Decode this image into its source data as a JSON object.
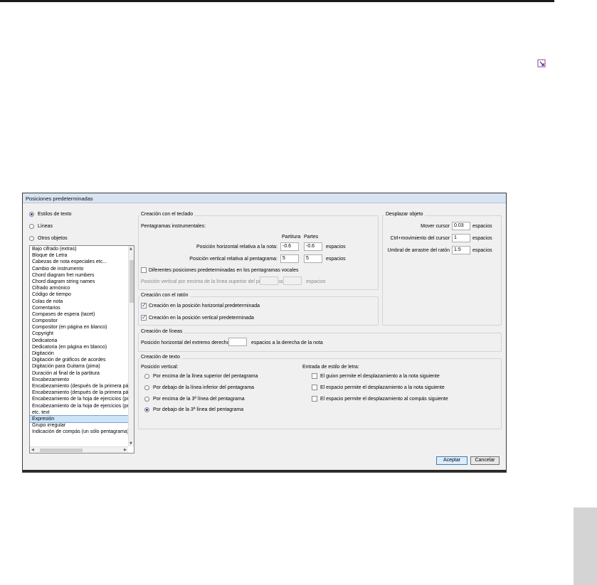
{
  "dialog": {
    "title": "Posiciones predeterminadas",
    "radios": [
      {
        "label": "Estilos de texto",
        "selected": true
      },
      {
        "label": "Líneas",
        "selected": false
      },
      {
        "label": "Otros objetos",
        "selected": false
      }
    ],
    "list_items": [
      "Bajo cifrado (extras)",
      "Bloque de Letra",
      "Cabezas de nota especiales etc...",
      "Cambio de instrumento",
      "Chord diagram fret numbers",
      "Chord diagram string names",
      "Cifrado armónico",
      "Código de tiempo",
      "Colas de nota",
      "Comentarios",
      "Compases de espera (tacet)",
      "Compositor",
      "Compositor (en página en blanco)",
      "Copyright",
      "Dedicatoria",
      "Dedicatoria (en página en blanco)",
      "Digitación",
      "Digitación de gráficos de acordes",
      "Digitación para Guitarra (pima)",
      "Duración al final de la partitura",
      "Encabezamiento",
      "Encabezamiento (después de la primera pág",
      "Encabezamiento (después de la primera pág",
      "Encabezamiento de la hoja de ejercicios (pri",
      "Encabezamiento de la hoja de ejercicios (pri",
      "etc. text",
      "Expresión",
      "Grupo irregular",
      "Indicación de compás (un sólo pentagrama)"
    ],
    "selected_list_item": "Expresión",
    "keyboard": {
      "title": "Creación con el teclado",
      "subtitle": "Pentagramas instrumentales:",
      "col_score": "Partitura",
      "col_parts": "Partes",
      "h_label": "Posición horizontal relativa a la nota:",
      "h_score": "-0.6",
      "h_parts": "-0.6",
      "v_label": "Posición vertical relativa al pentagrama:",
      "v_score": "5",
      "v_parts": "5",
      "units": "espacios",
      "vocal_check": "Diferentes posiciones predeterminadas en los pentagramas vocales",
      "vocal_label": "Posición vertical por encima de la línea superior del pentagrama:",
      "vocal_units": "espacios"
    },
    "move": {
      "title": "Desplazar objeto",
      "cursor_label": "Mover cursor",
      "cursor_value": "0.03",
      "ctrl_label": "Ctrl+movimiento del cursor",
      "ctrl_value": "1",
      "drag_label": "Umbral de arrastre del ratón",
      "drag_value": "1.5",
      "units": "espacios"
    },
    "mouse": {
      "title": "Creación con el ratón",
      "h_check": "Creación en la posición horizontal predeterminada",
      "v_check": "Creación en la posición vertical predeterminada"
    },
    "lines": {
      "title": "Creación de líneas",
      "label": "Posición horizontal del extremo derecho",
      "suffix": "espacios a la derecha de la nota"
    },
    "text": {
      "title": "Creación de texto",
      "vpos_title": "Posición vertical:",
      "vpos_options": [
        "Por encima de la línea superior del pentagrama",
        "Por debajo de la línea inferior del pentagrama",
        "Por encima de la 3ª línea del pentagrama",
        "Por debajo de la 3ª línea del pentagrama"
      ],
      "vpos_selected": 3,
      "entry_title": "Entrada de estilo de letra:",
      "entry_options": [
        "El guion permite el desplazamiento a la nota siguiente",
        "El espacio permite el desplazamiento a la nota siguiente",
        "El espacio permite el desplazamiento al compás siguiente"
      ]
    },
    "ok_label": "Aceptar",
    "cancel_label": "Cancelar"
  },
  "colors": {
    "accent": "#1d3f9e",
    "selection": "#cce4f7",
    "titlebar": "#d8e4f3"
  },
  "icons": {
    "corner": "resize-corner-icon"
  }
}
